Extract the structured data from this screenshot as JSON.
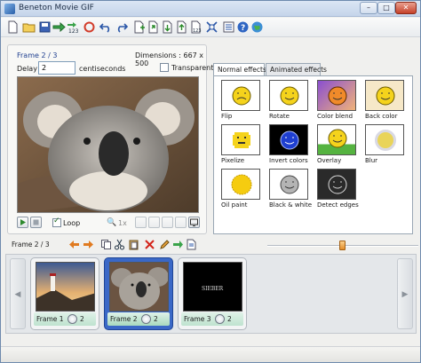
{
  "window": {
    "title": "Beneton Movie GIF"
  },
  "toolbar": {
    "icons": [
      "new-icon",
      "open-icon",
      "save-icon",
      "export-icon",
      "export-frames-icon",
      "refresh-icon",
      "undo-icon",
      "redo-icon",
      "add-frame-icon",
      "import-icon",
      "frame-down-icon",
      "frame-up-icon",
      "frame-order-icon",
      "resize-icon",
      "properties-icon",
      "help-icon",
      "web-icon"
    ]
  },
  "preview": {
    "frame_label": "Frame 2 / 3",
    "dimensions": "Dimensions : 667 x 500",
    "delay_label": "Delay",
    "delay_value": "2",
    "delay_unit": "centiseconds",
    "transparent_label": "Transparent",
    "transparent_checked": false,
    "loop_label": "Loop",
    "loop_checked": true,
    "zoom": "1x"
  },
  "effects": {
    "tabs": [
      {
        "label": "Normal effects",
        "active": true
      },
      {
        "label": "Animated effects",
        "active": false
      }
    ],
    "items": [
      {
        "label": "Flip"
      },
      {
        "label": "Rotate"
      },
      {
        "label": "Color blend"
      },
      {
        "label": "Back color"
      },
      {
        "label": "Pixelize"
      },
      {
        "label": "Invert colors"
      },
      {
        "label": "Overlay"
      },
      {
        "label": "Blur"
      },
      {
        "label": "Oil paint"
      },
      {
        "label": "Black & white"
      },
      {
        "label": "Detect edges"
      }
    ]
  },
  "frames": {
    "header_label": "Frame 2 / 3",
    "slider_position": 0.48,
    "items": [
      {
        "name": "Frame 1",
        "delay": "2",
        "selected": false
      },
      {
        "name": "Frame 2",
        "delay": "2",
        "selected": true
      },
      {
        "name": "Frame 3",
        "delay": "2",
        "selected": false,
        "text": "SIEBER"
      }
    ]
  },
  "colors": {
    "selected_frame": "#3a68c7",
    "accent": "#1f3f8f"
  }
}
